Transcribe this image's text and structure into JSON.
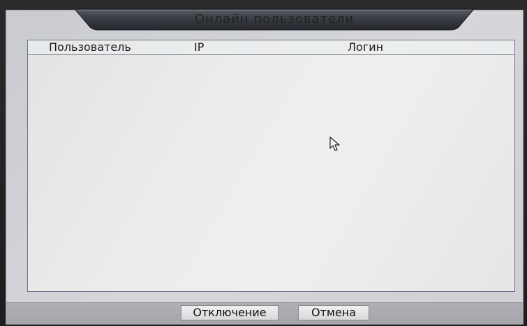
{
  "dialog": {
    "title": "Онлайн пользователи"
  },
  "table": {
    "columns": [
      "Пользователь",
      "IP",
      "Логин"
    ],
    "rows": []
  },
  "buttons": {
    "disconnect_label": "Отключение",
    "cancel_label": "Отмена"
  },
  "colors": {
    "panel_border": "#6e7286",
    "title_tab": "#3a3c44",
    "footer": "#aeb0b6"
  },
  "icons": {
    "cursor": "mouse-pointer-icon"
  }
}
